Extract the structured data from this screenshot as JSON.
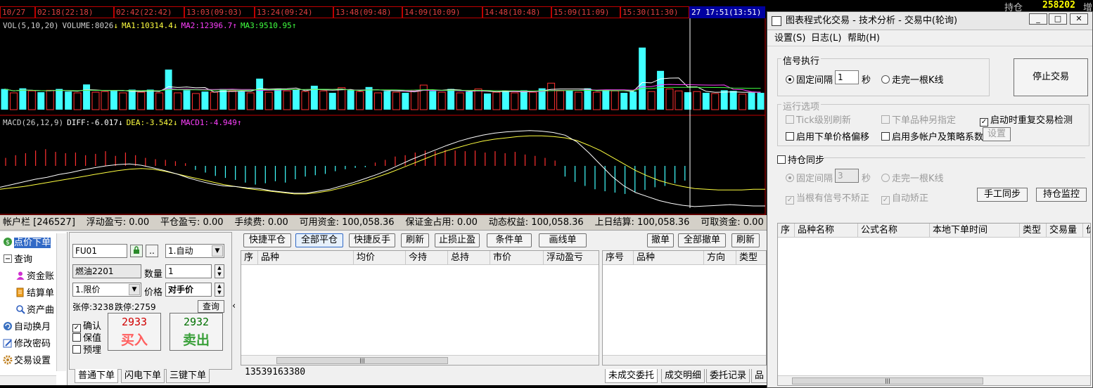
{
  "timebar": {
    "cells": [
      "10/27",
      "02:18(22:18)",
      "02:42(22:42)",
      "13:03(09:03)",
      "13:24(09:24)",
      "13:48(09:48)",
      "14:09(10:09)",
      "14:48(10:48)",
      "15:09(11:09)",
      "15:30(11:30)",
      "27 17:51(13:51)"
    ]
  },
  "quote": {
    "label": "持仓",
    "value": "258202",
    "more": "增"
  },
  "indicators": {
    "vol": {
      "name": "VOL(5,10,20)",
      "volume": "VOLUME:8026",
      "volume_arrow": "↓",
      "ma1": "MA1:10314.4",
      "ma1_arrow": "↓",
      "ma2": "MA2:12396.7",
      "ma2_arrow": "↑",
      "ma3": "MA3:9510.95",
      "ma3_arrow": "↑"
    },
    "macd": {
      "name": "MACD(26,12,9)",
      "diff": "DIFF:-6.017",
      "diff_arrow": "↓",
      "dea": "DEA:-3.542",
      "dea_arrow": "↓",
      "macd1": "MACD1:-4.949",
      "macd1_arrow": "↑"
    }
  },
  "colors": {
    "vol_up": "#ff3030",
    "vol_down": "#40ffff",
    "ma1": "#ffffff",
    "ma2": "#ff40ff",
    "ma3": "#40ff40",
    "dea": "#ffff40",
    "diff": "#ffffff",
    "macd_pos": "#ff3030",
    "macd_neg": "#40ffff",
    "cursor": "#ffffff"
  },
  "account_bar": {
    "items": [
      "帐户栏 [246527]",
      "浮动盈亏: 0.00",
      "平仓盈亏: 0.00",
      "手续费: 0.00",
      "可用资金: 100,058.36",
      "保证金占用: 0.00",
      "动态权益: 100,058.36",
      "上日结算: 100,058.36",
      "可取资金: 0.00"
    ]
  },
  "nav": {
    "items": [
      {
        "label": "点价下单",
        "icon": "coin-icon"
      },
      {
        "label": "查询",
        "icon": "minus-box-icon"
      },
      {
        "label": "资金账",
        "icon": "user-icon"
      },
      {
        "label": "结算单",
        "icon": "document-icon"
      },
      {
        "label": "资产曲",
        "icon": "magnifier-icon"
      },
      {
        "label": "自动换月",
        "icon": "refresh-icon"
      },
      {
        "label": "修改密码",
        "icon": "edit-icon"
      },
      {
        "label": "交易设置",
        "icon": "gear-icon"
      }
    ]
  },
  "order_form": {
    "account_code": "FU01",
    "lock_label": "",
    "dots_label": "..",
    "mode": "1.自动",
    "contract": "燃油2201",
    "qty_label": "数量",
    "qty": "1",
    "price_type": "1.限价",
    "price_label": "价格",
    "price": "对手价",
    "limit_up": "张停:3238",
    "limit_down": "跌停:2759",
    "query_label": "查询",
    "confirm_label": "确认",
    "hedge_label": "保值",
    "preset_label": "预埋",
    "buy_price": "2933",
    "buy_label": "买入",
    "sell_price": "2932",
    "sell_label": "卖出"
  },
  "order_tabs": [
    "普通下单",
    "闪电下单",
    "三键下单"
  ],
  "pos_toolbar": [
    "快捷平仓",
    "全部平仓",
    "快捷反手",
    "刷新",
    "止损止盈",
    "条件单",
    "画线单"
  ],
  "pos_columns": [
    "序",
    "品种",
    "均价",
    "今持",
    "总持",
    "市价",
    "浮动盈亏"
  ],
  "phone": "13539163380",
  "order_toolbar": [
    "撤单",
    "全部撤单",
    "刷新"
  ],
  "order_columns": [
    "序号",
    "品种",
    "方向",
    "类型"
  ],
  "bottom_tabs": [
    "未成交委托",
    "成交明细",
    "委托记录",
    "品"
  ],
  "dialog": {
    "title": "图表程式化交易 - 技术分析 - 交易中(轮询)",
    "menu": [
      "设置(S)",
      "日志(L)",
      "帮助(H)"
    ],
    "signal_group": "信号执行",
    "fixed_interval": "固定间隔",
    "interval_value": "1",
    "seconds": "秒",
    "bar_complete": "走完一根K线",
    "stop_button": "停止交易",
    "run_group": "运行选项",
    "tick_refresh": "Tick级别刷新",
    "symbol_specify": "下单品种另指定",
    "restart_check": "启动时重复交易检测",
    "price_offset": "启用下单价格偏移",
    "multi_account": "启用多帐户及策略系数",
    "setup_button": "设置",
    "sync_label": "持仓同步",
    "sync_fixed": "固定间隔",
    "sync_value": "3",
    "sync_seconds": "秒",
    "sync_bar": "走完一根K线",
    "no_correct": "当根有信号不矫正",
    "auto_correct": "自动矫正",
    "manual_sync": "手工同步",
    "pos_monitor": "持仓监控",
    "columns": [
      "序",
      "品种名称",
      "公式名称",
      "本地下单时间",
      "类型",
      "交易量",
      "价"
    ]
  },
  "chart_data": {
    "type": "bar",
    "volume": [
      {
        "v": 3200,
        "up": false
      },
      {
        "v": 2600,
        "up": true
      },
      {
        "v": 3300,
        "up": false
      },
      {
        "v": 2900,
        "up": true
      },
      {
        "v": 2700,
        "up": false
      },
      {
        "v": 3000,
        "up": true
      },
      {
        "v": 3200,
        "up": false
      },
      {
        "v": 2800,
        "up": false
      },
      {
        "v": 2600,
        "up": true
      },
      {
        "v": 3900,
        "up": false
      },
      {
        "v": 2700,
        "up": true
      },
      {
        "v": 2800,
        "up": true
      },
      {
        "v": 2900,
        "up": false
      },
      {
        "v": 2600,
        "up": true
      },
      {
        "v": 3100,
        "up": false
      },
      {
        "v": 2700,
        "up": true
      },
      {
        "v": 3100,
        "up": false
      },
      {
        "v": 2600,
        "up": true
      },
      {
        "v": 6200,
        "up": false
      },
      {
        "v": 2600,
        "up": true
      },
      {
        "v": 3000,
        "up": false
      },
      {
        "v": 2500,
        "up": true
      },
      {
        "v": 2800,
        "up": false
      },
      {
        "v": 2700,
        "up": true
      },
      {
        "v": 3200,
        "up": false
      },
      {
        "v": 2900,
        "up": true
      },
      {
        "v": 2800,
        "up": false
      },
      {
        "v": 2600,
        "up": true
      },
      {
        "v": 4800,
        "up": false
      },
      {
        "v": 2700,
        "up": true
      },
      {
        "v": 3200,
        "up": false
      },
      {
        "v": 2900,
        "up": true
      },
      {
        "v": 3100,
        "up": false
      },
      {
        "v": 2800,
        "up": true
      },
      {
        "v": 3700,
        "up": false
      },
      {
        "v": 2900,
        "up": true
      },
      {
        "v": 2600,
        "up": false
      },
      {
        "v": 3400,
        "up": true
      },
      {
        "v": 3000,
        "up": false
      },
      {
        "v": 2800,
        "up": true
      },
      {
        "v": 3500,
        "up": false
      },
      {
        "v": 2600,
        "up": true
      },
      {
        "v": 2900,
        "up": false
      },
      {
        "v": 2700,
        "up": true
      },
      {
        "v": 2600,
        "up": false
      },
      {
        "v": 3000,
        "up": true
      },
      {
        "v": 3800,
        "up": true
      },
      {
        "v": 2900,
        "up": false
      },
      {
        "v": 2700,
        "up": true
      },
      {
        "v": 3200,
        "up": false
      },
      {
        "v": 2600,
        "up": true
      },
      {
        "v": 2800,
        "up": false
      },
      {
        "v": 3200,
        "up": true
      },
      {
        "v": 2500,
        "up": false
      },
      {
        "v": 2700,
        "up": true
      },
      {
        "v": 2900,
        "up": false
      },
      {
        "v": 2600,
        "up": true
      },
      {
        "v": 3000,
        "up": false
      },
      {
        "v": 2700,
        "up": true
      },
      {
        "v": 3300,
        "up": false
      },
      {
        "v": 4100,
        "up": true
      },
      {
        "v": 2900,
        "up": true
      },
      {
        "v": 3000,
        "up": false
      },
      {
        "v": 2700,
        "up": true
      },
      {
        "v": 3300,
        "up": false
      },
      {
        "v": 2700,
        "up": true
      },
      {
        "v": 3100,
        "up": false
      },
      {
        "v": 2900,
        "up": true
      },
      {
        "v": 2600,
        "up": false
      },
      {
        "v": 2800,
        "up": false
      },
      {
        "v": 9600,
        "up": false
      },
      {
        "v": 2800,
        "up": true
      },
      {
        "v": 6000,
        "up": false
      },
      {
        "v": 3200,
        "up": true
      },
      {
        "v": 2900,
        "up": true
      },
      {
        "v": 2700,
        "up": false
      },
      {
        "v": 2800,
        "up": true
      },
      {
        "v": 2600,
        "up": false
      },
      {
        "v": 2500,
        "up": true
      },
      {
        "v": 3000,
        "up": false
      },
      {
        "v": 2900,
        "up": false
      },
      {
        "v": 2400,
        "up": true
      },
      {
        "v": 2600,
        "up": false
      },
      {
        "v": 2600,
        "up": false
      }
    ],
    "macd_hist": [
      1.2,
      1.6,
      1.9,
      2.3,
      2.5,
      2.1,
      1.9,
      2.0,
      1.6,
      1.8,
      2.2,
      1.5,
      2.0,
      1.6,
      1.2,
      1.0,
      0.9,
      0.7,
      0.4,
      -0.6,
      -1.0,
      -1.5,
      -1.8,
      -2.1,
      -2.5,
      -2.8,
      -2.6,
      -2.3,
      -2.5,
      -2.0,
      -1.6,
      -1.4,
      -1.2,
      -0.8,
      -0.5,
      -0.3,
      -0.2,
      0.5,
      0.9,
      1.4,
      1.6,
      2.0,
      2.3,
      2.2,
      2.4,
      2.3,
      2.2,
      2.3,
      2.0,
      2.2,
      1.9,
      2.1,
      1.7,
      1.5,
      1.2,
      0.8,
      -1.6,
      -2.4,
      -3.0,
      -3.5,
      -3.8,
      -4.0,
      -4.2,
      -4.0,
      -3.6,
      -3.2,
      -3.0,
      -2.6,
      -2.2
    ],
    "diff": [
      -3.2,
      -2.8,
      -2.4,
      -2.0,
      -1.7,
      -1.3,
      -1.0,
      -0.6,
      -0.3,
      0.0,
      0.2,
      0.3,
      0.1,
      -0.3,
      -0.7,
      -1.2,
      -1.8,
      -2.3,
      -2.7,
      -3.0,
      -3.1,
      -3.3,
      -3.4,
      -3.7,
      -3.9,
      -4.1,
      -4.1,
      -3.8,
      -3.5,
      -3.0,
      -2.5,
      -1.9,
      -1.3,
      -0.6,
      0.2,
      1.0,
      1.7,
      2.4,
      3.1,
      3.7,
      4.2,
      4.6,
      4.9,
      5.1,
      5.2,
      5.3,
      5.2,
      5.0,
      4.6,
      3.6,
      2.0,
      0.2,
      -1.6,
      -3.0,
      -4.0,
      -4.6,
      -5.2,
      -5.6,
      -5.9,
      -6.1,
      -6.0,
      -5.9,
      -5.8,
      -5.9,
      -6.0,
      -6.0
    ],
    "dea": [
      -3.5,
      -3.3,
      -3.1,
      -2.8,
      -2.5,
      -2.2,
      -1.9,
      -1.6,
      -1.3,
      -1.0,
      -0.7,
      -0.5,
      -0.4,
      -0.5,
      -0.8,
      -1.2,
      -1.6,
      -2.0,
      -2.4,
      -2.8,
      -3.1,
      -3.4,
      -3.6,
      -3.8,
      -4.0,
      -4.2,
      -4.2,
      -4.0,
      -3.7,
      -3.3,
      -2.8,
      -2.3,
      -1.7,
      -1.1,
      -0.4,
      0.3,
      1.0,
      1.7,
      2.3,
      2.8,
      3.3,
      3.7,
      4.0,
      4.2,
      4.4,
      4.5,
      4.5,
      4.4,
      4.2,
      3.8,
      3.1,
      2.3,
      1.3,
      0.3,
      -0.7,
      -1.5,
      -2.2,
      -2.7,
      -3.1,
      -3.4,
      -3.5,
      -3.6,
      -3.6,
      -3.6,
      -3.5,
      -3.5
    ]
  }
}
